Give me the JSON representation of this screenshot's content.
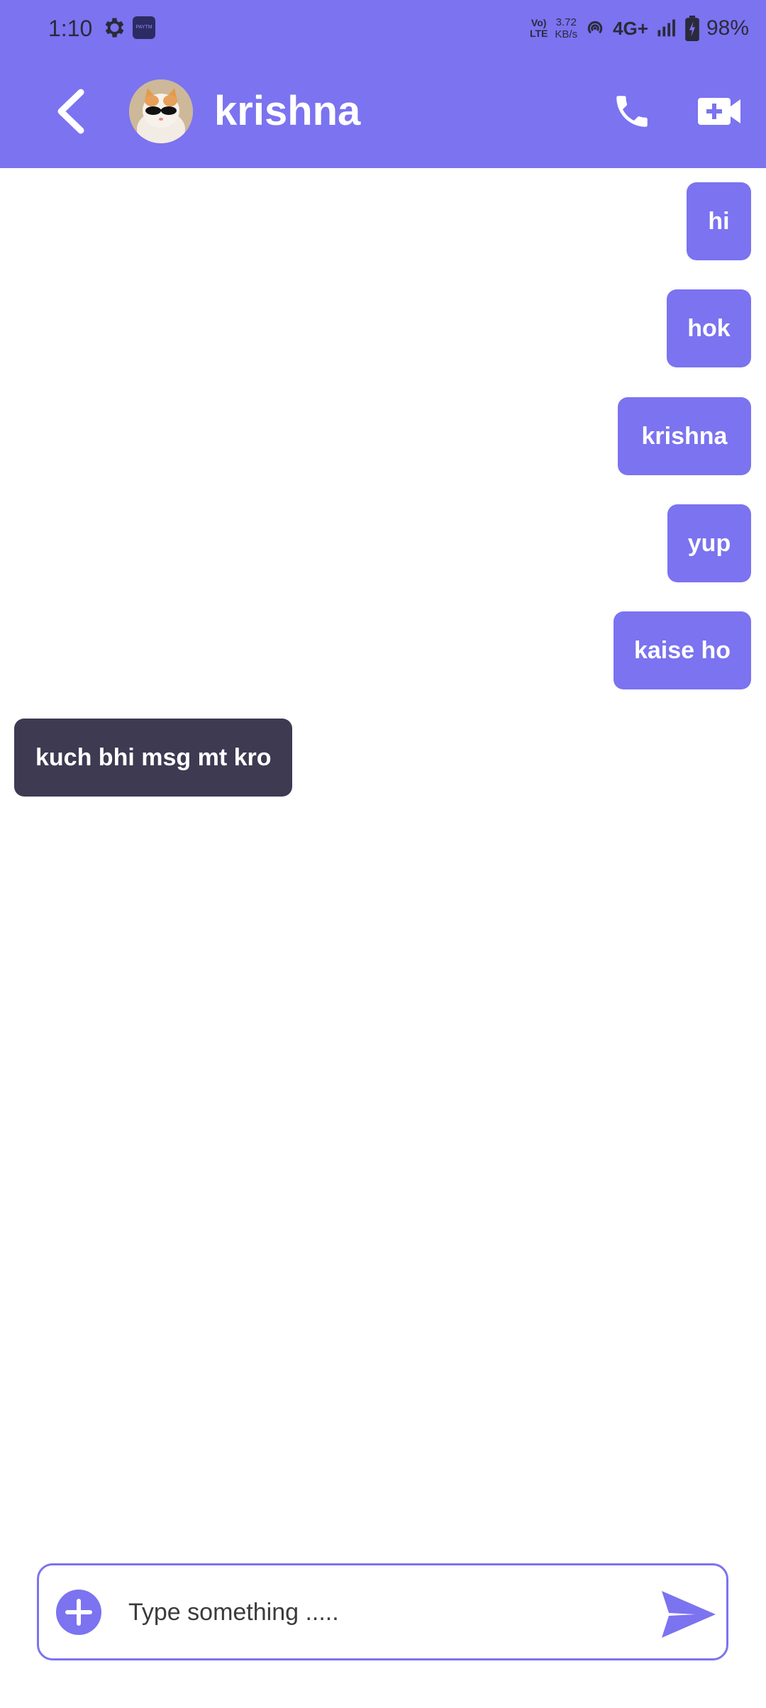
{
  "status_bar": {
    "time": "1:10",
    "app_icon_text": "PAYTM",
    "volte_line1": "Vo)",
    "volte_line2": "LTE",
    "net_speed_value": "3.72",
    "net_speed_unit": "KB/s",
    "network_type": "4G+",
    "battery": "98%"
  },
  "header": {
    "contact_name": "krishna",
    "background_color": "#7b73f0"
  },
  "messages": [
    {
      "text": "hi",
      "direction": "sent"
    },
    {
      "text": "hok",
      "direction": "sent"
    },
    {
      "text": "krishna",
      "direction": "sent"
    },
    {
      "text": "yup",
      "direction": "sent"
    },
    {
      "text": "kaise ho",
      "direction": "sent"
    },
    {
      "text": "kuch bhi msg mt kro",
      "direction": "received"
    }
  ],
  "composer": {
    "placeholder": "Type something .....",
    "value": ""
  },
  "colors": {
    "accent": "#7b73f0",
    "received_bubble": "#3d3a52"
  }
}
